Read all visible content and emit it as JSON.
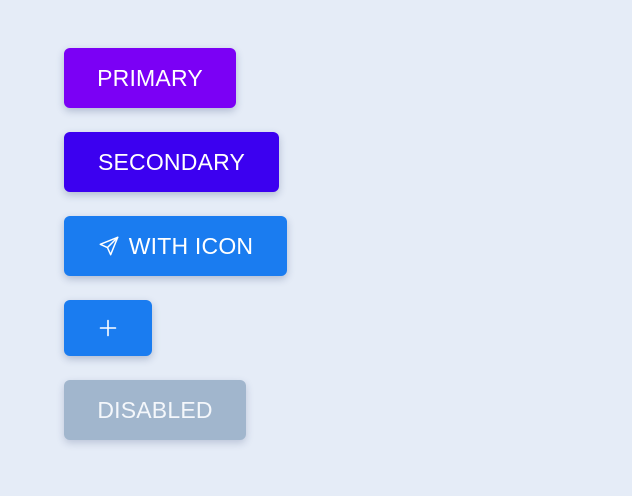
{
  "buttons": {
    "primary": {
      "label": "PRIMARY"
    },
    "secondary": {
      "label": "SECONDARY"
    },
    "with_icon": {
      "label": "WITH ICON",
      "icon": "send-icon"
    },
    "icon_only": {
      "icon": "plus-icon"
    },
    "disabled": {
      "label": "DISABLED"
    }
  },
  "colors": {
    "background": "#e5ecf7",
    "primary": "#7b00f5",
    "secondary": "#3c00f0",
    "accent": "#1a7cf0",
    "disabled": "#a1b6cd"
  }
}
